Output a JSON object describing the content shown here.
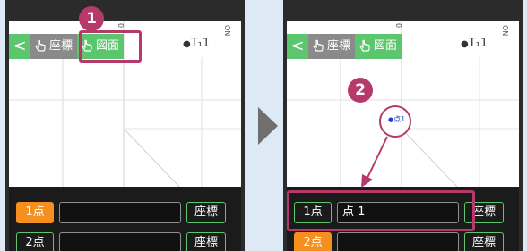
{
  "colors": {
    "background": "#dde9f5",
    "accent_green": "#5cc66e",
    "highlight": "#b5396b",
    "active_orange": "#f5901f",
    "transition_arrow": "#6f6f6f"
  },
  "left": {
    "toolbar": {
      "back_label": "<",
      "coord_label": "座標",
      "drawing_label": "図面",
      "hand_icon": "pointing-hand-icon"
    },
    "point_label": "T₁1",
    "edge_mark": "ON",
    "mid_mark": "0",
    "rows": [
      {
        "num": "1点",
        "value": "",
        "coord": "座標",
        "active": true
      },
      {
        "num": "2点",
        "value": "",
        "coord": "座標",
        "active": false
      }
    ],
    "step_badge": "1"
  },
  "right": {
    "toolbar": {
      "back_label": "<",
      "coord_label": "座標",
      "drawing_label": "図面",
      "hand_icon": "pointing-hand-icon"
    },
    "point_label": "T₁1",
    "edge_mark": "ON",
    "mid_mark": "0",
    "selected_point": "点1",
    "rows": [
      {
        "num": "1点",
        "value": "点 1",
        "coord": "座標",
        "active": false
      },
      {
        "num": "2点",
        "value": "",
        "coord": "座標",
        "active": true
      }
    ],
    "step_badge": "2"
  },
  "transition_icon": "right-triangle-icon"
}
